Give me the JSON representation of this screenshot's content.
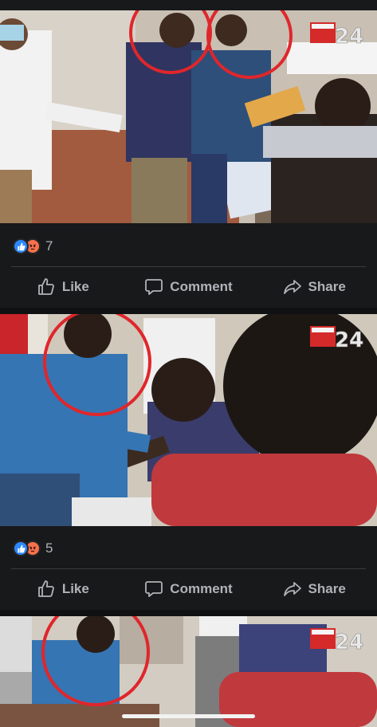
{
  "feed": {
    "posts": [
      {
        "watermark": "24",
        "reaction_count": "7",
        "actions": {
          "like": "Like",
          "comment": "Comment",
          "share": "Share"
        }
      },
      {
        "watermark": "24",
        "reaction_count": "5",
        "actions": {
          "like": "Like",
          "comment": "Comment",
          "share": "Share"
        }
      },
      {
        "watermark": "24"
      }
    ]
  },
  "colors": {
    "background": "#18191a",
    "like_blue": "#2d88ff",
    "angry_orange": "#f7714c",
    "highlight_circle": "#e0262b"
  },
  "icons": [
    "like-reaction-icon",
    "angry-reaction-icon",
    "thumbs-up-icon",
    "comment-bubble-icon",
    "share-arrow-icon"
  ]
}
